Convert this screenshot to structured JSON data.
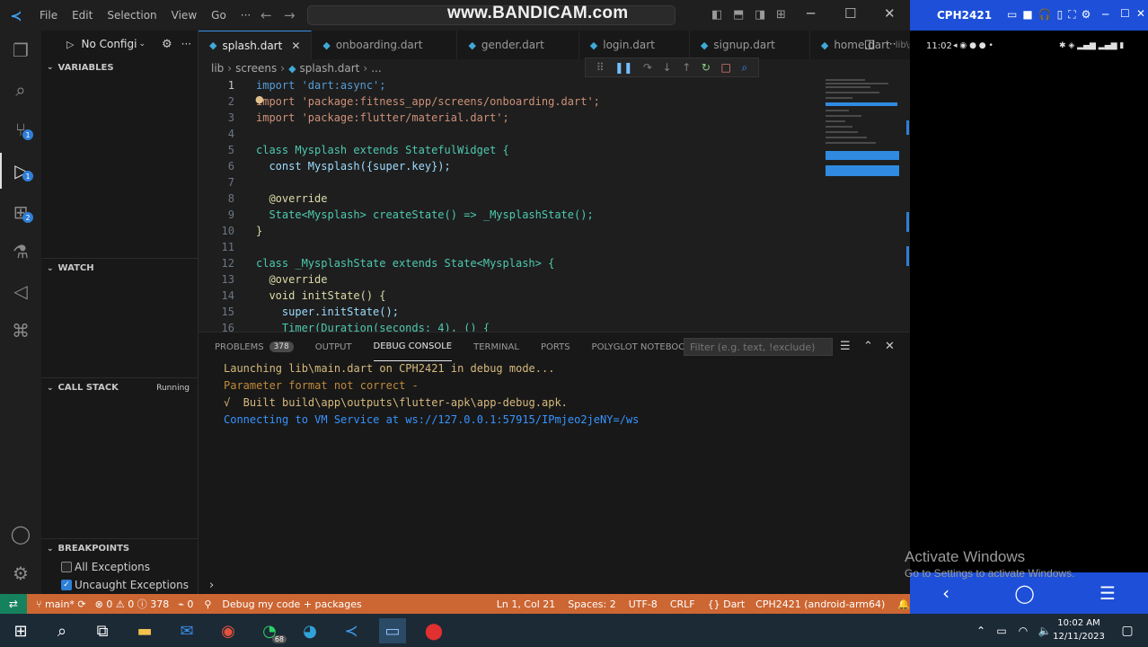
{
  "titlebar": {
    "menus": [
      "File",
      "Edit",
      "Selection",
      "View",
      "Go"
    ],
    "ellipsis": "···",
    "watermark": "www.BANDICAM.com"
  },
  "sidebar": {
    "run_config": "No Configi",
    "sections": {
      "variables": "VARIABLES",
      "watch": "WATCH",
      "call_stack": "CALL STACK",
      "call_stack_status": "Running",
      "breakpoints": "BREAKPOINTS"
    },
    "breakpoints": [
      {
        "label": "All Exceptions",
        "checked": false
      },
      {
        "label": "Uncaught Exceptions",
        "checked": true
      }
    ]
  },
  "activity_badges": {
    "source_control": "1",
    "run_debug": "1",
    "extensions": "2"
  },
  "tabs": [
    {
      "label": "splash.dart",
      "active": true
    },
    {
      "label": "onboarding.dart",
      "active": false
    },
    {
      "label": "gender.dart",
      "active": false
    },
    {
      "label": "login.dart",
      "active": false
    },
    {
      "label": "signup.dart",
      "active": false
    },
    {
      "label": "home.dart",
      "active": false,
      "suffix": "lib\\scr"
    }
  ],
  "breadcrumb": [
    "lib",
    "screens",
    "splash.dart",
    "..."
  ],
  "code": [
    {
      "n": "1",
      "t": "import 'dart:async';"
    },
    {
      "n": "2",
      "t": "import 'package:fitness_app/screens/onboarding.dart';"
    },
    {
      "n": "3",
      "t": "import 'package:flutter/material.dart';"
    },
    {
      "n": "4",
      "t": ""
    },
    {
      "n": "5",
      "t": "class Mysplash extends StatefulWidget {"
    },
    {
      "n": "6",
      "t": "  const Mysplash({super.key});"
    },
    {
      "n": "7",
      "t": ""
    },
    {
      "n": "8",
      "t": "  @override"
    },
    {
      "n": "9",
      "t": "  State<Mysplash> createState() => _MysplashState();"
    },
    {
      "n": "10",
      "t": "}"
    },
    {
      "n": "11",
      "t": ""
    },
    {
      "n": "12",
      "t": "class _MysplashState extends State<Mysplash> {"
    },
    {
      "n": "13",
      "t": "  @override"
    },
    {
      "n": "14",
      "t": "  void initState() {"
    },
    {
      "n": "15",
      "t": "    super.initState();"
    },
    {
      "n": "16",
      "t": "    Timer(Duration(seconds: 4), () {"
    }
  ],
  "panel": {
    "tabs": [
      "PROBLEMS",
      "OUTPUT",
      "DEBUG CONSOLE",
      "TERMINAL",
      "PORTS",
      "POLYGLOT NOTEBOOK"
    ],
    "problems_count": "378",
    "active_tab": "DEBUG CONSOLE",
    "filter_placeholder": "Filter (e.g. text, !exclude)",
    "console": [
      {
        "text": "Launching lib\\main.dart on CPH2421 in debug mode...",
        "color": "#d7ba7d"
      },
      {
        "text": "Parameter format not correct -",
        "color": "#c08a3a"
      },
      {
        "text": "√  Built build\\app\\outputs\\flutter-apk\\app-debug.apk.",
        "color": "#d7ba7d"
      },
      {
        "text": "Connecting to VM Service at ws://127.0.0.1:57915/IPmjeo2jeNY=/ws",
        "color": "#3794ff"
      }
    ]
  },
  "statusbar": {
    "branch": "main*",
    "errors": "0",
    "warnings": "0",
    "infos": "378",
    "ports": "0",
    "debug_target": "Debug my code + packages",
    "position": "Ln 1, Col 21",
    "spaces": "Spaces: 2",
    "encoding": "UTF-8",
    "eol": "CRLF",
    "language": "Dart",
    "device": "CPH2421 (android-arm64)"
  },
  "phone": {
    "title": "CPH2421",
    "time": "11:02",
    "activate_title": "Activate Windows",
    "activate_sub": "Go to Settings to activate Windows."
  },
  "taskbar": {
    "whatsapp_badge": "68",
    "clock_time": "10:02 AM",
    "clock_date": "12/11/2023"
  }
}
